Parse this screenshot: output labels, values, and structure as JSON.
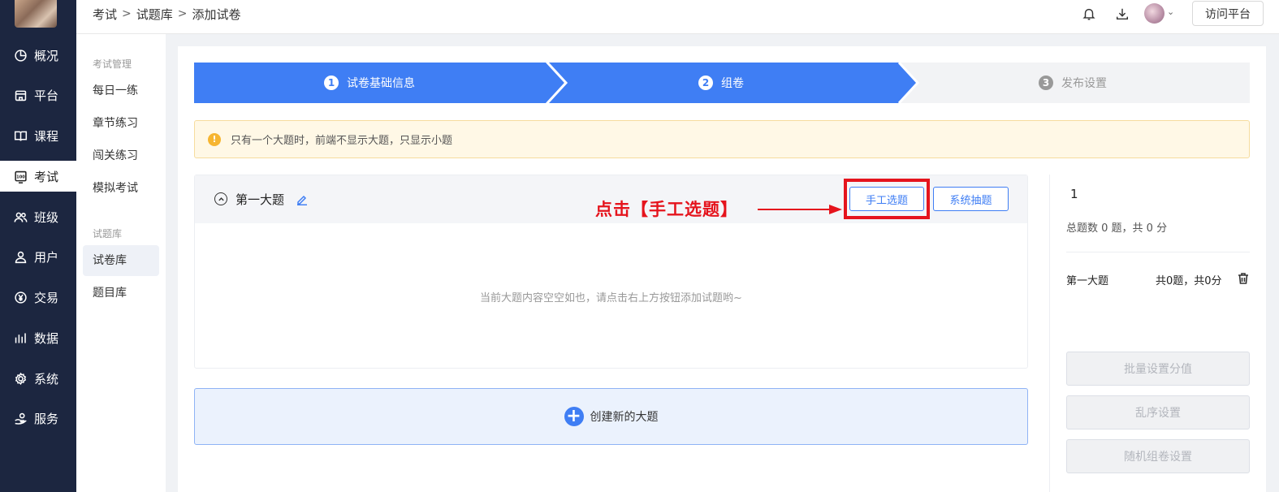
{
  "nav": {
    "items": [
      {
        "label": "概况",
        "icon": "pie-chart-icon"
      },
      {
        "label": "平台",
        "icon": "store-icon"
      },
      {
        "label": "课程",
        "icon": "book-icon"
      },
      {
        "label": "考试",
        "icon": "exam-100-icon"
      },
      {
        "label": "班级",
        "icon": "group-icon"
      },
      {
        "label": "用户",
        "icon": "user-icon"
      },
      {
        "label": "交易",
        "icon": "yen-circle-icon"
      },
      {
        "label": "数据",
        "icon": "bar-chart-icon"
      },
      {
        "label": "系统",
        "icon": "gear-icon"
      },
      {
        "label": "服务",
        "icon": "hand-service-icon"
      }
    ],
    "active": "考试"
  },
  "submenu": {
    "group1": "考试管理",
    "items1": [
      "每日一练",
      "章节练习",
      "闯关练习",
      "模拟考试"
    ],
    "group2": "试题库",
    "items2": [
      "试卷库",
      "题目库"
    ],
    "active": "试卷库"
  },
  "header": {
    "breadcrumb": [
      "考试",
      "试题库",
      "添加试卷"
    ],
    "visit_button": "访问平台"
  },
  "steps": [
    {
      "num": "1",
      "label": "试卷基础信息",
      "state": "done"
    },
    {
      "num": "2",
      "label": "组卷",
      "state": "active"
    },
    {
      "num": "3",
      "label": "发布设置",
      "state": "pending"
    }
  ],
  "alert": {
    "text": "只有一个大题时，前端不显示大题，只显示小题"
  },
  "section": {
    "title": "第一大题",
    "manual_button": "手工选题",
    "system_button": "系统抽题",
    "annotation": "点击【手工选题】",
    "empty_text": "当前大题内容空空如也，请点击右上方按钮添加试题哟~"
  },
  "create_button": "创建新的大题",
  "right_panel": {
    "count": "1",
    "total": "总题数 0 题，共 0 分",
    "section_name": "第一大题",
    "section_score": "共0题，共0分",
    "buttons": [
      "批量设置分值",
      "乱序设置",
      "随机组卷设置"
    ]
  },
  "colors": {
    "primary": "#3f7ef4",
    "nav_bg": "#1c2640",
    "annotation_red": "#e5141d",
    "alert_bg": "#fff8e6"
  }
}
